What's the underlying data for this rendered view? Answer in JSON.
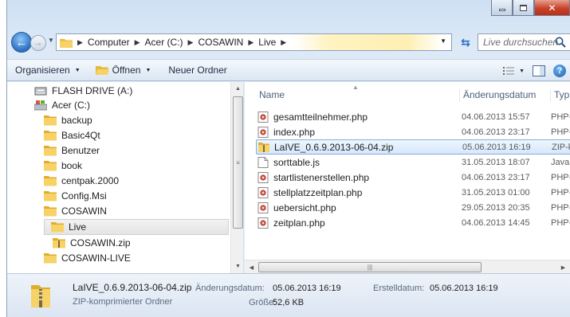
{
  "address_bar": {
    "crumbs": [
      "Computer",
      "Acer (C:)",
      "COSAWIN",
      "Live"
    ],
    "search_placeholder": "Live durchsuchen"
  },
  "toolbar": {
    "organize_label": "Organisieren",
    "open_label": "Öffnen",
    "new_folder_label": "Neuer Ordner"
  },
  "nav_tree": {
    "items": [
      {
        "label": "FLASH DRIVE (A:)",
        "icon": "drive-icon"
      },
      {
        "label": "Acer (C:)",
        "icon": "drive-icon"
      },
      {
        "label": "backup",
        "icon": "folder-icon"
      },
      {
        "label": "Basic4Qt",
        "icon": "folder-icon"
      },
      {
        "label": "Benutzer",
        "icon": "folder-icon"
      },
      {
        "label": "book",
        "icon": "folder-icon"
      },
      {
        "label": "centpak.2000",
        "icon": "folder-icon"
      },
      {
        "label": "Config.Msi",
        "icon": "folder-icon"
      },
      {
        "label": "COSAWIN",
        "icon": "folder-icon"
      },
      {
        "label": "Live",
        "icon": "folder-icon"
      },
      {
        "label": "COSAWIN.zip",
        "icon": "zip-icon"
      },
      {
        "label": "COSAWIN-LIVE",
        "icon": "folder-icon"
      }
    ]
  },
  "columns": {
    "name": "Name",
    "date": "Änderungsdatum",
    "type": "Typ"
  },
  "files": [
    {
      "name": "gesamtteilnehmer.php",
      "date": "04.06.2013 15:57",
      "type": "PHP-Datei",
      "icon": "php-icon"
    },
    {
      "name": "index.php",
      "date": "04.06.2013 23:17",
      "type": "PHP-Datei",
      "icon": "php-icon"
    },
    {
      "name": "LaIVE_0.6.9.2013-06-04.zip",
      "date": "05.06.2013 16:19",
      "type": "ZIP-komprimierter Ordner",
      "icon": "zip-icon"
    },
    {
      "name": "sorttable.js",
      "date": "31.05.2013 18:07",
      "type": "JavaScript-Datei",
      "icon": "js-icon"
    },
    {
      "name": "startlistenerstellen.php",
      "date": "04.06.2013 23:17",
      "type": "PHP-Datei",
      "icon": "php-icon"
    },
    {
      "name": "stellplatzzeitplan.php",
      "date": "31.05.2013 01:00",
      "type": "PHP-Datei",
      "icon": "php-icon"
    },
    {
      "name": "uebersicht.php",
      "date": "29.05.2013 20:35",
      "type": "PHP-Datei",
      "icon": "php-icon"
    },
    {
      "name": "zeitplan.php",
      "date": "04.06.2013 14:45",
      "type": "PHP-Datei",
      "icon": "php-icon"
    }
  ],
  "details": {
    "name": "LaIVE_0.6.9.2013-06-04.zip",
    "type": "ZIP-komprimierter Ordner",
    "modified_label": "Änderungsdatum:",
    "modified_value": "05.06.2013 16:19",
    "created_label": "Erstelldatum:",
    "created_value": "05.06.2013 16:19",
    "size_label": "Größe:",
    "size_value": "52,6 KB"
  }
}
